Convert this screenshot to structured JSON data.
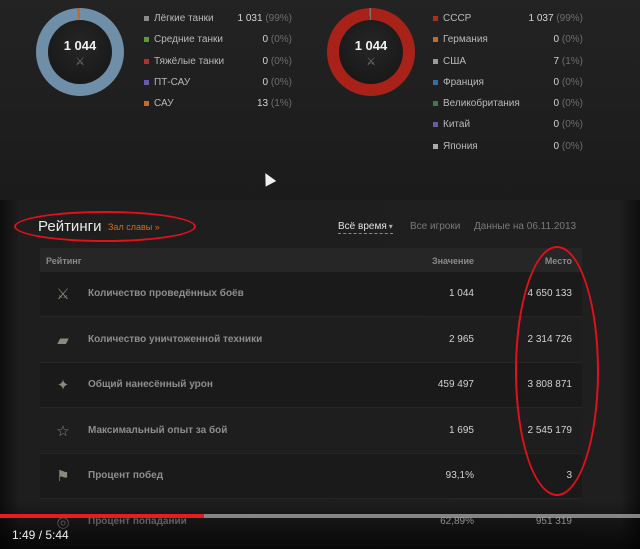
{
  "vehicle_types": {
    "total": "1 044",
    "colors": {
      "ring": "#6f8ea7",
      "accent": "#c46a2a"
    },
    "items": [
      {
        "label": "Лёгкие танки",
        "value": "1 031",
        "pct": "(99%)",
        "icon": "light-tank-icon",
        "color": "#8a8a8a"
      },
      {
        "label": "Средние танки",
        "value": "0",
        "pct": "(0%)",
        "icon": "medium-tank-icon",
        "color": "#5a9a3a"
      },
      {
        "label": "Тяжёлые танки",
        "value": "0",
        "pct": "(0%)",
        "icon": "heavy-tank-icon",
        "color": "#b03030"
      },
      {
        "label": "ПТ-САУ",
        "value": "0",
        "pct": "(0%)",
        "icon": "at-spg-icon",
        "color": "#6a5aa6"
      },
      {
        "label": "САУ",
        "value": "13",
        "pct": "(1%)",
        "icon": "spg-icon",
        "color": "#c46a2a"
      }
    ]
  },
  "nations": {
    "total": "1 044",
    "colors": {
      "ring": "#a82219"
    },
    "items": [
      {
        "label": "СССР",
        "value": "1 037",
        "pct": "(99%)",
        "icon": "ussr-flag-icon",
        "color": "#b02a20"
      },
      {
        "label": "Германия",
        "value": "0",
        "pct": "(0%)",
        "icon": "germany-flag-icon",
        "color": "#c46a2a"
      },
      {
        "label": "США",
        "value": "7",
        "pct": "(1%)",
        "icon": "usa-flag-icon",
        "color": "#9a9a9a"
      },
      {
        "label": "Франция",
        "value": "0",
        "pct": "(0%)",
        "icon": "france-flag-icon",
        "color": "#3a6aa6"
      },
      {
        "label": "Великобритания",
        "value": "0",
        "pct": "(0%)",
        "icon": "uk-flag-icon",
        "color": "#3a7a4a"
      },
      {
        "label": "Китай",
        "value": "0",
        "pct": "(0%)",
        "icon": "china-flag-icon",
        "color": "#6a5aa6"
      },
      {
        "label": "Япония",
        "value": "0",
        "pct": "(0%)",
        "icon": "japan-flag-icon",
        "color": "#aaaaaa"
      }
    ]
  },
  "ratings": {
    "title": "Рейтинги",
    "hall_of_fame": "Зал славы »",
    "period": "Всё время",
    "all_players": "Все игроки",
    "data_date": "Данные на 06.11.2013",
    "columns": {
      "rating": "Рейтинг",
      "value": "Значение",
      "place": "Место"
    },
    "rows": [
      {
        "label": "Количество проведённых боёв",
        "value": "1 044",
        "place": "4 650 133",
        "icon": "crossed-swords-icon",
        "glyph": "⚔"
      },
      {
        "label": "Количество уничтоженной техники",
        "value": "2 965",
        "place": "2 314 726",
        "icon": "destroyed-tank-icon",
        "glyph": "▰"
      },
      {
        "label": "Общий нанесённый урон",
        "value": "459 497",
        "place": "3 808 871",
        "icon": "damage-icon",
        "glyph": "✦"
      },
      {
        "label": "Максимальный опыт за бой",
        "value": "1 695",
        "place": "2 545 179",
        "icon": "star-icon",
        "glyph": "☆"
      },
      {
        "label": "Процент побед",
        "value": "93,1%",
        "place": "3",
        "icon": "flag-icon",
        "glyph": "⚑"
      },
      {
        "label": "Процент попаданий",
        "value": "62,89%",
        "place": "951 319",
        "icon": "target-icon",
        "glyph": "◎"
      }
    ]
  },
  "video": {
    "time": "1:49 / 5:44",
    "progress": 0.318
  }
}
